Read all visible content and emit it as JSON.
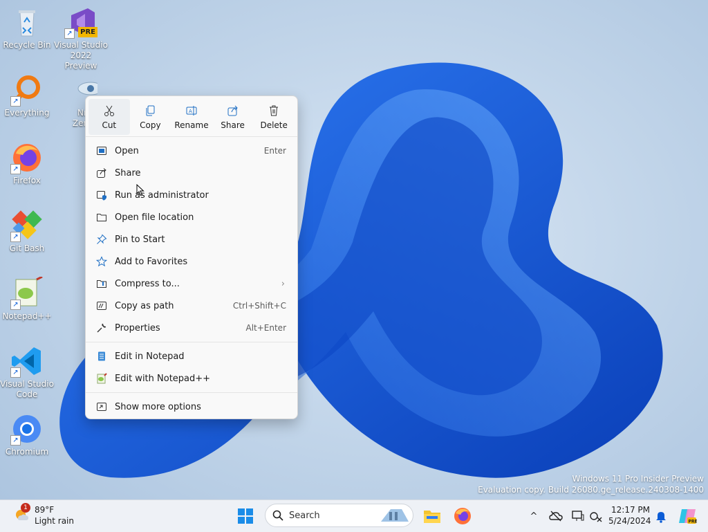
{
  "desktop": {
    "icons": [
      {
        "label": "Recycle Bin"
      },
      {
        "label": "Visual Studio 2022 Preview",
        "badge": "PRE"
      },
      {
        "label": "Everything"
      },
      {
        "label": "Nma Zenma"
      },
      {
        "label": "Firefox"
      },
      {
        "label": "Git Bash"
      },
      {
        "label": "Notepad++"
      },
      {
        "label": "Visual Studio Code"
      },
      {
        "label": "Chromium"
      }
    ]
  },
  "context_menu": {
    "quick_actions": [
      {
        "label": "Cut",
        "icon": "scissors-icon"
      },
      {
        "label": "Copy",
        "icon": "copy-icon"
      },
      {
        "label": "Rename",
        "icon": "rename-icon"
      },
      {
        "label": "Share",
        "icon": "share-icon"
      },
      {
        "label": "Delete",
        "icon": "trash-icon"
      }
    ],
    "items": [
      {
        "label": "Open",
        "shortcut": "Enter"
      },
      {
        "label": "Share",
        "shortcut": ""
      },
      {
        "label": "Run as administrator",
        "shortcut": ""
      },
      {
        "label": "Open file location",
        "shortcut": ""
      },
      {
        "label": "Pin to Start",
        "shortcut": ""
      },
      {
        "label": "Add to Favorites",
        "shortcut": ""
      },
      {
        "label": "Compress to...",
        "shortcut": ""
      },
      {
        "label": "Copy as path",
        "shortcut": "Ctrl+Shift+C"
      },
      {
        "label": "Properties",
        "shortcut": "Alt+Enter"
      },
      {
        "label": "Edit in Notepad",
        "shortcut": ""
      },
      {
        "label": "Edit with Notepad++",
        "shortcut": ""
      },
      {
        "label": "Show more options",
        "shortcut": ""
      }
    ]
  },
  "taskbar": {
    "weather": {
      "temp": "89°F",
      "condition": "Light rain",
      "badge": "1"
    },
    "search_placeholder": "Search",
    "clock": {
      "time": "12:17 PM",
      "date": "5/24/2024"
    }
  },
  "watermark": {
    "line1": "Windows 11 Pro Insider Preview",
    "line2": "Evaluation copy. Build 26080.ge_release.240308-1400"
  },
  "colors": {
    "accent": "#0067c0",
    "wallpaper_blue": "#1556d8"
  }
}
